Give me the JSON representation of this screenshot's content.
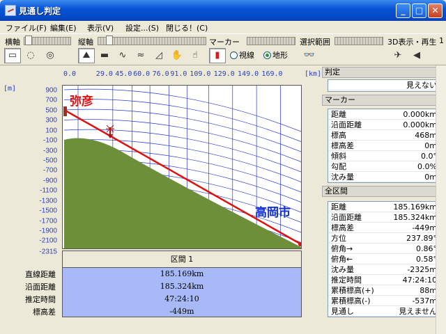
{
  "window": {
    "title": "見通し判定"
  },
  "menu": [
    "ファイル(F)",
    "編集(E)",
    "表示(V)",
    "設定...(S)",
    "閉じる！(C)"
  ],
  "toolbar": {
    "x_axis_label": "横軸",
    "y_axis_label": "縦軸",
    "marker_label": "マーカー",
    "range_label": "選択範囲",
    "view3d_label": "3D表示・再生",
    "view3d_value": "1",
    "radio_sightline": "視線",
    "radio_terrain": "地形",
    "selected_radio": "terrain",
    "icons": [
      "ruler-icon",
      "circle-icon",
      "circle-zoom-icon",
      "mountain-icon",
      "flat-bar-icon",
      "wave-icon",
      "wave-icon-2",
      "slope-icon",
      "hand-icon",
      "hand-icon-2",
      "marker-pin-icon",
      "binoculars-icon",
      "3d-icon",
      "rewind-icon"
    ]
  },
  "axis": {
    "x_unit": "[km]",
    "y_unit": "[m]",
    "x_ticks": [
      "0.0",
      "29.0",
      "45.0",
      "60.0",
      "76.0",
      "91.0",
      "109.0",
      "129.0",
      "149.0",
      "169.0"
    ],
    "y_ticks": [
      "900",
      "700",
      "500",
      "300",
      "100",
      "-100",
      "-300",
      "-500",
      "-700",
      "-900",
      "-1100",
      "-1300",
      "-1500",
      "-1700",
      "-1900",
      "-2100",
      "-2315"
    ]
  },
  "plot": {
    "start_name": "弥彦",
    "end_name": "高岡市",
    "colors": {
      "terrain": "#6e8f3a",
      "sightline": "#e01010",
      "grid": "#2a3ccf",
      "start_label": "#e01010",
      "end_label": "#1230d8"
    }
  },
  "section": {
    "header": "区間 1",
    "labels": [
      "直線距離",
      "沿面距離",
      "推定時間",
      "標高差"
    ],
    "values": [
      "185.169km",
      "185.324km",
      "47:24:10",
      "-449m"
    ]
  },
  "judgement": {
    "header": "判定",
    "value": "見えない"
  },
  "marker": {
    "header": "マーカー",
    "rows": [
      {
        "k": "距離",
        "v": "0.000km"
      },
      {
        "k": "沿面距離",
        "v": "0.000km"
      },
      {
        "k": "標高",
        "v": "468m"
      },
      {
        "k": "標高差",
        "v": "0m"
      },
      {
        "k": "傾斜",
        "v": "0.0°"
      },
      {
        "k": "勾配",
        "v": "0.0%"
      },
      {
        "k": "沈み量",
        "v": "0m"
      }
    ]
  },
  "all_sections": {
    "header": "全区間",
    "rows": [
      {
        "k": "距離",
        "v": "185.169km"
      },
      {
        "k": "沿面距離",
        "v": "185.324km"
      },
      {
        "k": "標高差",
        "v": "-449m"
      },
      {
        "k": "方位",
        "v": "237.89°"
      },
      {
        "k": "俯角→",
        "v": "0.86°"
      },
      {
        "k": "俯角←",
        "v": "0.58°"
      },
      {
        "k": "沈み量",
        "v": "-2325m"
      },
      {
        "k": "推定時間",
        "v": "47:24:10"
      },
      {
        "k": "累積標高(+)",
        "v": "88m"
      },
      {
        "k": "累積標高(-)",
        "v": "-537m"
      },
      {
        "k": "見通し",
        "v": "見えません"
      }
    ]
  }
}
